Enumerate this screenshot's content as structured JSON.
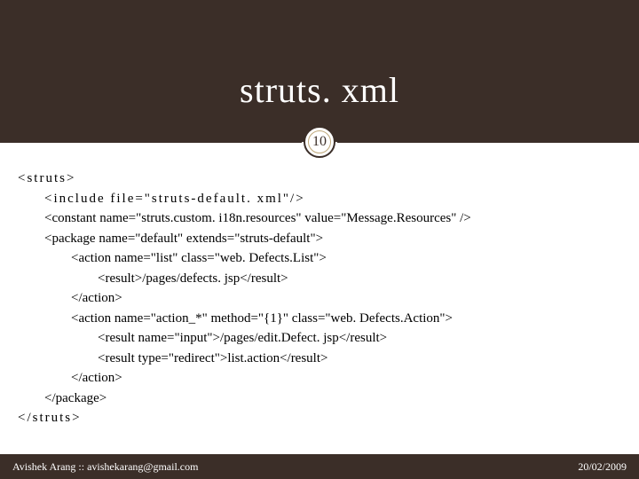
{
  "title": "struts. xml",
  "slide_number": "10",
  "code": {
    "l0": "<struts>",
    "l1": "<include file=\"struts-default. xml\"/>",
    "l2": "<constant name=\"struts.custom. i18n.resources\" value=\"Message.Resources\" />",
    "l3": "<package name=\"default\" extends=\"struts-default\">",
    "l4": "<action name=\"list\" class=\"web. Defects.List\">",
    "l5": "<result>/pages/defects. jsp</result>",
    "l6": "</action>",
    "l7": "<action name=\"action_*\" method=\"{1}\" class=\"web. Defects.Action\">",
    "l8": "<result name=\"input\">/pages/edit.Defect. jsp</result>",
    "l9": "<result type=\"redirect\">list.action</result>",
    "l10": "</action>",
    "l11": "</package>",
    "l12": "</struts>"
  },
  "footer": {
    "left": "Avishek Arang :: avishekarang@gmail.com",
    "right": "20/02/2009"
  }
}
